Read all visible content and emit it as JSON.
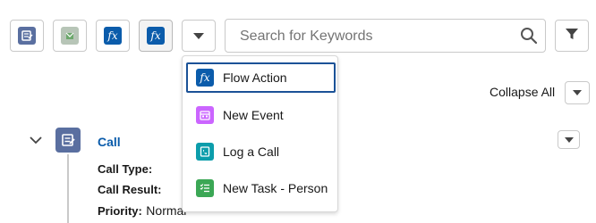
{
  "toolbar": {
    "buttons": [
      {
        "name": "call-type-filter",
        "icon": "log-call-icon",
        "color": "#5867e8"
      },
      {
        "name": "email-type-filter",
        "icon": "email-icon",
        "color": "#939393"
      },
      {
        "name": "flow-action-filter",
        "icon": "formula-icon",
        "color": "#0b5cab"
      },
      {
        "name": "flow-action-filter-active",
        "icon": "formula-icon",
        "color": "#0b5cab"
      }
    ],
    "dropdown_icon": "chevron-down-icon",
    "filter_icon": "filter-icon"
  },
  "search": {
    "placeholder": "Search for Keywords",
    "value": "",
    "icon": "search-icon"
  },
  "menu": {
    "items": [
      {
        "label": "Flow Action",
        "icon": "formula-icon",
        "color": "#0b5cab",
        "focused": true
      },
      {
        "label": "New Event",
        "icon": "event-icon",
        "color": "#cb65ff"
      },
      {
        "label": "Log a Call",
        "icon": "log-call-icon",
        "color": "#0c9dab"
      },
      {
        "label": "New Task - Person",
        "icon": "task-icon",
        "color": "#3ba755"
      }
    ]
  },
  "timeline": {
    "collapse_label": "Collapse All",
    "item": {
      "title": "Call",
      "icon": "call-record-icon",
      "icon_color": "#5a6fa0",
      "fields": [
        {
          "label": "Call Type:",
          "value": ""
        },
        {
          "label": "Call Result:",
          "value": ""
        },
        {
          "label": "Priority:",
          "value": "Normal"
        }
      ]
    }
  }
}
